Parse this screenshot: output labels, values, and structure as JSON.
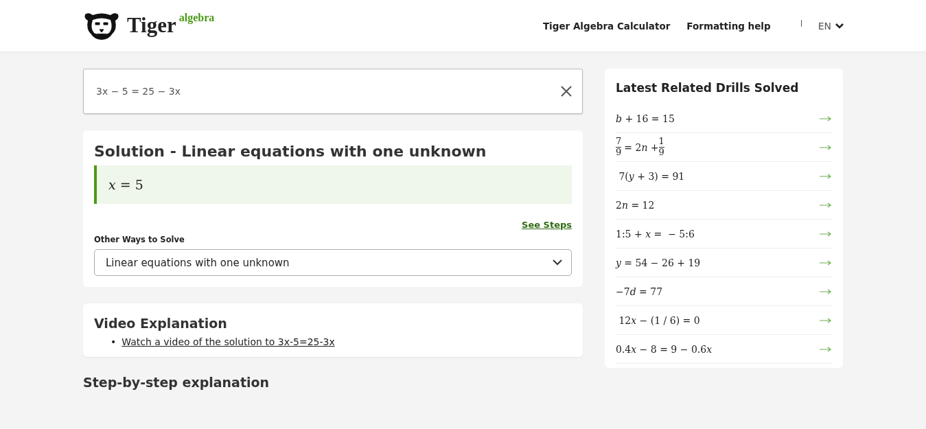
{
  "header": {
    "logo_word": "Tiger",
    "logo_sup": "algebra",
    "nav": [
      "Tiger Algebra Calculator",
      "Formatting help"
    ],
    "language": "EN"
  },
  "input": {
    "value": "3x − 5 = 25 − 3x"
  },
  "solution": {
    "title": "Solution - Linear equations with one unknown",
    "answer": "*x* = 5",
    "see_steps": "See Steps",
    "other_ways_label": "Other Ways to Solve",
    "method": "Linear equations with one unknown"
  },
  "video": {
    "title": "Video Explanation",
    "links": [
      {
        "bullet": "•",
        "text": "Watch a video of the solution to 3x-5=25-3x"
      }
    ]
  },
  "step_heading": "Step-by-step explanation",
  "drills": {
    "title": "Latest Related Drills Solved",
    "items": [
      {
        "kind": "inline",
        "parts": [
          "*b*",
          " + 16 = 15"
        ]
      },
      {
        "kind": "fraction",
        "parts": [
          {
            "num": "7",
            "den": "9"
          },
          {
            "text": "= 2"
          },
          {
            "text": "*n*"
          },
          {
            "text": " +"
          },
          {
            "num": "1",
            "den": "9"
          }
        ]
      },
      {
        "kind": "inline",
        "parts": [
          " 7(",
          "*y*",
          " + 3) = 91"
        ]
      },
      {
        "kind": "inline",
        "parts": [
          "2",
          "*n*",
          " = 12"
        ]
      },
      {
        "kind": "inline",
        "parts": [
          "1:5 + ",
          "*x*",
          " =  − 5:6"
        ]
      },
      {
        "kind": "inline",
        "parts": [
          "*y*",
          " = 54 − 26 + 19"
        ]
      },
      {
        "kind": "inline",
        "parts": [
          "−7",
          "*d*",
          " = 77"
        ]
      },
      {
        "kind": "inline",
        "parts": [
          " 12",
          "*x*",
          " − (1 / 6) = 0"
        ]
      },
      {
        "kind": "inline",
        "parts": [
          "0.4",
          "*x*",
          " − 8 = 9 − 0.6",
          "*x*"
        ]
      }
    ]
  }
}
